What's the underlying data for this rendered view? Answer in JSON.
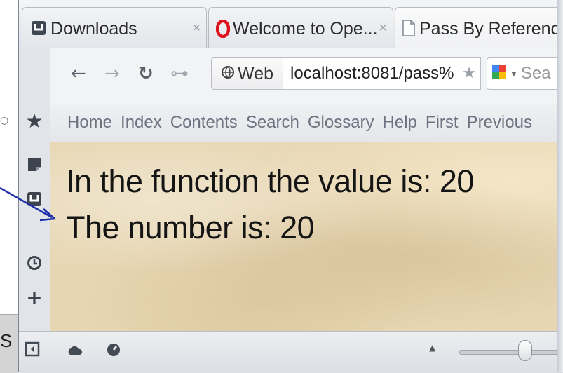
{
  "background": {
    "left_fragment": "S"
  },
  "tabs": [
    {
      "label": "Downloads",
      "close": "×",
      "icon": "downloads-icon"
    },
    {
      "label": "Welcome to Ope...",
      "close": "×",
      "icon": "opera-logo-icon"
    },
    {
      "label": "Pass By Referenc...",
      "close": "",
      "icon": "page-icon"
    }
  ],
  "nav": {
    "back": "←",
    "forward": "→",
    "reload": "↻",
    "key": "⊶",
    "web_label": "Web",
    "address": "localhost:8081/pass%",
    "bookmark_star": "★",
    "search_placeholder": "Sea"
  },
  "sidebar": {
    "items": [
      {
        "icon": "bookmarks-star-icon",
        "glyph": "★"
      },
      {
        "icon": "notes-icon",
        "glyph": ""
      },
      {
        "icon": "downloads-icon",
        "glyph": ""
      },
      {
        "icon": "history-clock-icon",
        "glyph": ""
      },
      {
        "icon": "add-panel-icon",
        "glyph": "+"
      }
    ]
  },
  "bookmarks": [
    "Home",
    "Index",
    "Contents",
    "Search",
    "Glossary",
    "Help",
    "First",
    "Previous"
  ],
  "content": {
    "line1": "In the function the value is: 20",
    "line2": "The number is: 20"
  },
  "statusbar": {
    "zoom_arrow": "▲"
  },
  "colors": {
    "page_background": "#e7d6b2",
    "annotation_arrow": "#1d2fa8",
    "opera_red": "#e0141e"
  }
}
